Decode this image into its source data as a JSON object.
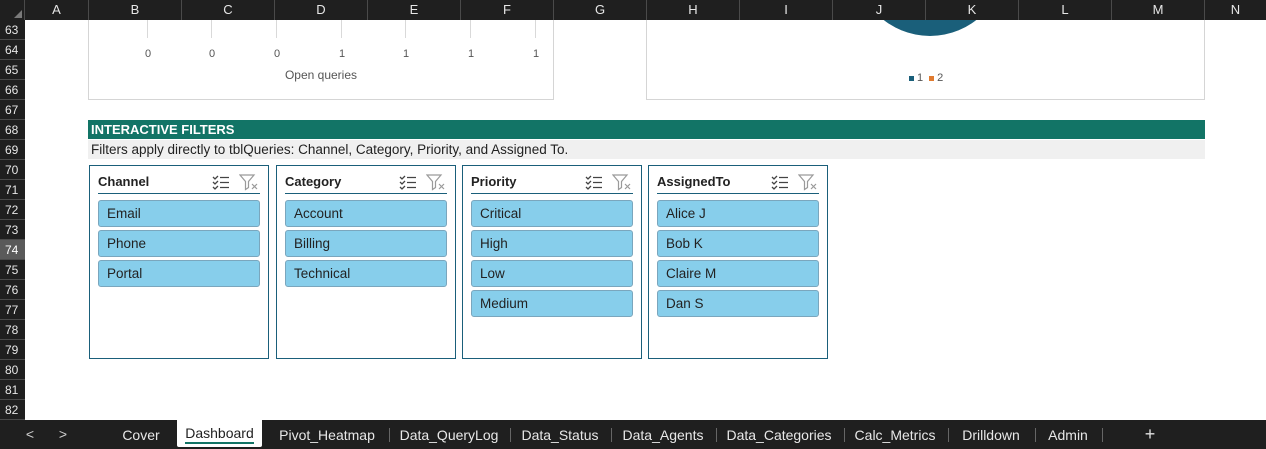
{
  "columns": [
    "A",
    "B",
    "C",
    "D",
    "E",
    "F",
    "G",
    "H",
    "I",
    "J",
    "K",
    "L",
    "M",
    "N"
  ],
  "rows": [
    "63",
    "64",
    "65",
    "66",
    "67",
    "68",
    "69",
    "70",
    "71",
    "72",
    "73",
    "74",
    "75",
    "76",
    "77",
    "78",
    "79",
    "80",
    "81",
    "82"
  ],
  "active_row": "74",
  "chart_left": {
    "ticks": [
      "0",
      "0",
      "0",
      "1",
      "1",
      "1",
      "1"
    ],
    "axis_title": "Open queries"
  },
  "chart_right": {
    "legend": [
      "1",
      "2"
    ],
    "colors": {
      "series1": "#1a5f7a",
      "series2": "#e07b30"
    }
  },
  "filters": {
    "title": "INTERACTIVE FILTERS",
    "subtitle": "Filters apply directly to tblQueries: Channel, Category, Priority, and Assigned To.",
    "slicers": [
      {
        "title": "Channel",
        "items": [
          "Email",
          "Phone",
          "Portal"
        ]
      },
      {
        "title": "Category",
        "items": [
          "Account",
          "Billing",
          "Technical"
        ]
      },
      {
        "title": "Priority",
        "items": [
          "Critical",
          "High",
          "Low",
          "Medium"
        ]
      },
      {
        "title": "AssignedTo",
        "items": [
          "Alice J",
          "Bob K",
          "Claire M",
          "Dan S"
        ]
      }
    ]
  },
  "tabs": {
    "prev": "<",
    "next": ">",
    "sheets": [
      "Cover",
      "Dashboard",
      "Pivot_Heatmap",
      "Data_QueryLog",
      "Data_Status",
      "Data_Agents",
      "Data_Categories",
      "Calc_Metrics",
      "Drilldown",
      "Admin"
    ],
    "active": "Dashboard",
    "add": "+"
  },
  "colors": {
    "banner": "#127466",
    "slicer_item": "#87ceeb",
    "slicer_border": "#1a5f7a"
  }
}
